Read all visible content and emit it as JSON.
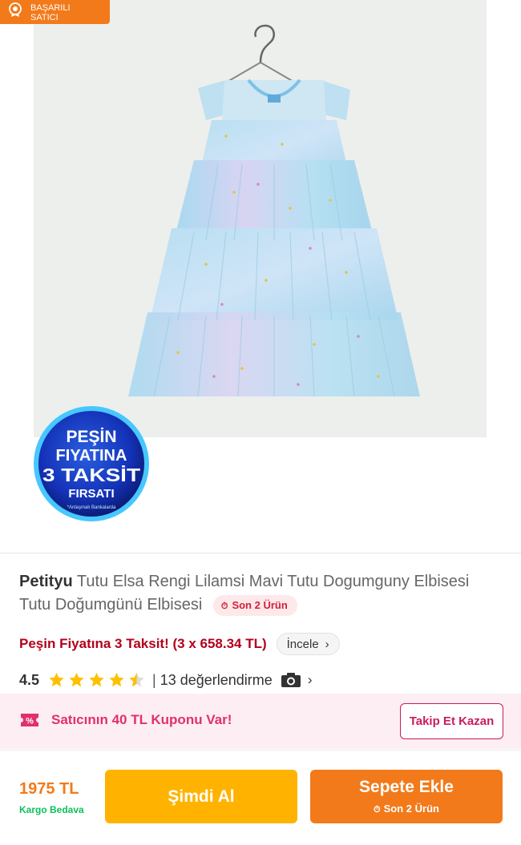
{
  "seller_badge": {
    "line1": "BAŞARILI",
    "line2": "SATICI"
  },
  "promo": {
    "line1": "PEŞİN",
    "line2": "FIYATINA",
    "line3": "3 TAKSİT",
    "line4": "FIRSATI",
    "line5": "*Anlaşmalı Bankalarda"
  },
  "product": {
    "brand": "Petityu",
    "title": "Tutu Elsa Rengi Lilamsi Mavi Tutu Dogumguny Elbisesi Tutu Doğumgünü Elbisesi",
    "stock_badge": "Son 2 Ürün",
    "stock_icon": "clock-icon"
  },
  "installment": {
    "text": "Peşin Fiyatına 3 Taksit! (3 x 658.34 TL)",
    "button": "İncele"
  },
  "rating": {
    "value": "4.5",
    "stars": 4.5,
    "separator": "|",
    "reviews": "13 değerlendirme"
  },
  "coupon": {
    "text": "Satıcının 40 TL Kuponu Var!",
    "button": "Takip Et Kazan"
  },
  "bottom_bar": {
    "price": "1975 TL",
    "shipping": "Kargo Bedava",
    "buy_now": "Şimdi Al",
    "add_to_cart": "Sepete Ekle",
    "add_to_cart_sub": "Son 2 Ürün"
  },
  "colors": {
    "accent": "#f27a1a",
    "buy_now": "#ffb300",
    "coupon_pink": "#e0306f",
    "stock_red": "#d21f3c",
    "shipping_green": "#0bc15c"
  }
}
